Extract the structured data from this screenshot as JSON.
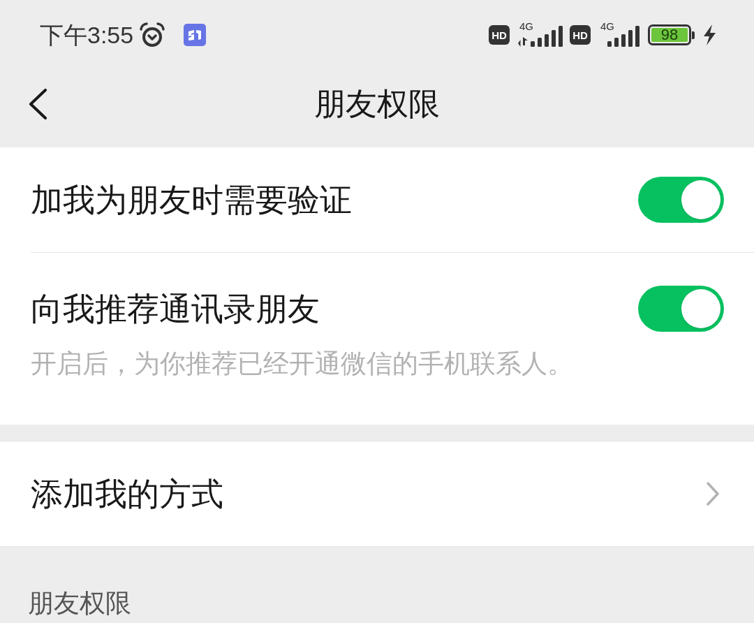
{
  "status_bar": {
    "time": "下午3:55",
    "networks": [
      {
        "badge": "HD",
        "type": "4G",
        "data_activity": true
      },
      {
        "badge": "HD",
        "type": "4G",
        "data_activity": false
      }
    ],
    "battery": {
      "reading": "98",
      "charging": true
    }
  },
  "nav_bar": {
    "title": "朋友权限"
  },
  "sections": [
    {
      "rows": [
        {
          "kind": "toggle",
          "label": "加我为朋友时需要验证",
          "on": true
        },
        {
          "kind": "toggle",
          "label": "向我推荐通讯录朋友",
          "on": true,
          "description": "开启后，为你推荐已经开通微信的手机联系人。"
        }
      ]
    },
    {
      "rows": [
        {
          "kind": "link",
          "label": "添加我的方式"
        }
      ]
    }
  ],
  "footer_section": {
    "header": "朋友权限"
  }
}
